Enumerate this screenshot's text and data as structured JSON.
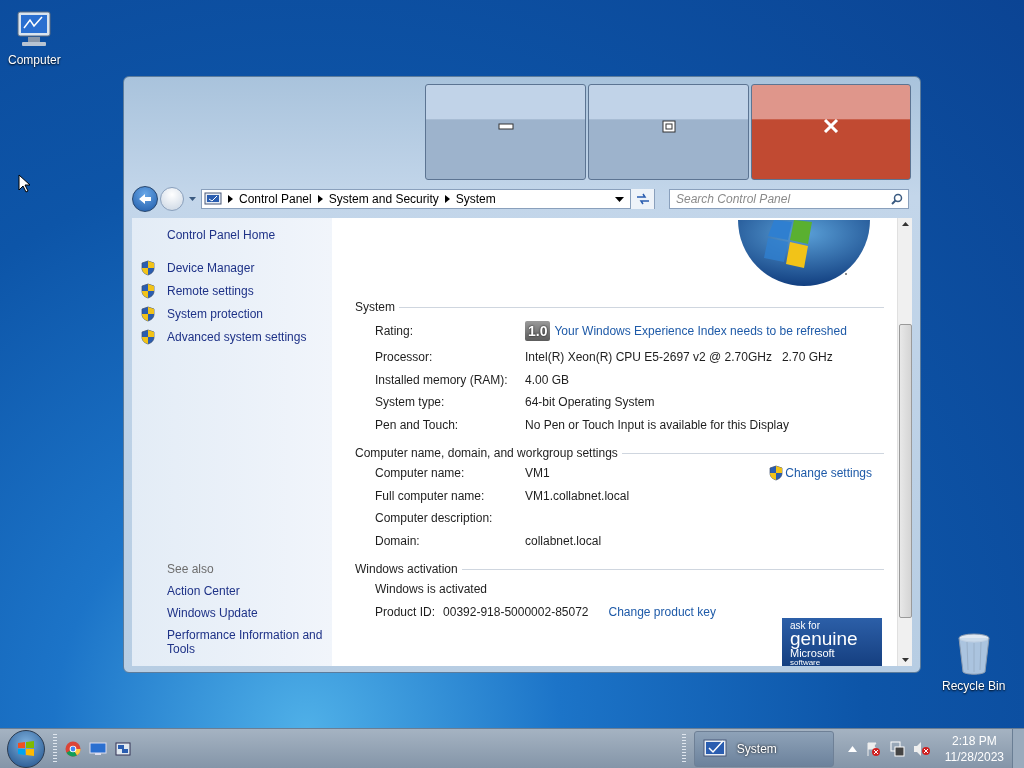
{
  "desktop_icons": [
    {
      "label": "Computer",
      "kind": "computer"
    },
    {
      "label": "Recycle Bin",
      "kind": "bin"
    }
  ],
  "window": {
    "address_bar": {
      "breadcrumbs": [
        "Control Panel",
        "System and Security",
        "System"
      ]
    },
    "search": {
      "placeholder": "Search Control Panel"
    },
    "sidebar": {
      "home": "Control Panel Home",
      "tasks": [
        "Device Manager",
        "Remote settings",
        "System protection",
        "Advanced system settings"
      ],
      "see_also_title": "See also",
      "see_also": [
        "Action Center",
        "Windows Update",
        "Performance Information and Tools"
      ]
    },
    "sections": [
      {
        "title": "System",
        "rows": [
          {
            "kind": "rating",
            "label": "Rating:",
            "badge": "1.0",
            "link": "Your Windows Experience Index needs to be refreshed"
          },
          {
            "kind": "text",
            "label": "Processor:",
            "value": "Intel(R) Xeon(R) CPU E5-2697 v2 @ 2.70GHz   2.70 GHz"
          },
          {
            "kind": "text",
            "label": "Installed memory (RAM):",
            "value": "4.00 GB"
          },
          {
            "kind": "text",
            "label": "System type:",
            "value": "64-bit Operating System"
          },
          {
            "kind": "text",
            "label": "Pen and Touch:",
            "value": "No Pen or Touch Input is available for this Display"
          }
        ]
      },
      {
        "title": "Computer name, domain, and workgroup settings",
        "rows": [
          {
            "kind": "text",
            "label": "Computer name:",
            "value": "VM1",
            "link": "Change settings"
          },
          {
            "kind": "text",
            "label": "Full computer name:",
            "value": "VM1.collabnet.local"
          },
          {
            "kind": "text",
            "label": "Computer description:"
          },
          {
            "kind": "text",
            "label": "Domain:",
            "value": "collabnet.local"
          }
        ]
      },
      {
        "title": "Windows activation",
        "rows": [
          {
            "kind": "status",
            "label": "Windows is activated"
          },
          {
            "kind": "product",
            "label": "Product ID:",
            "value": "00392-918-5000002-85072",
            "link": "Change product key"
          }
        ]
      }
    ],
    "genuine_badge": {
      "line_1": "ask for",
      "line_2": "genuine",
      "line_3": "Microsoft",
      "line_4": "software"
    }
  },
  "taskbar": {
    "task_button": "System",
    "time": "2:18 PM",
    "date": "11/28/2023"
  }
}
